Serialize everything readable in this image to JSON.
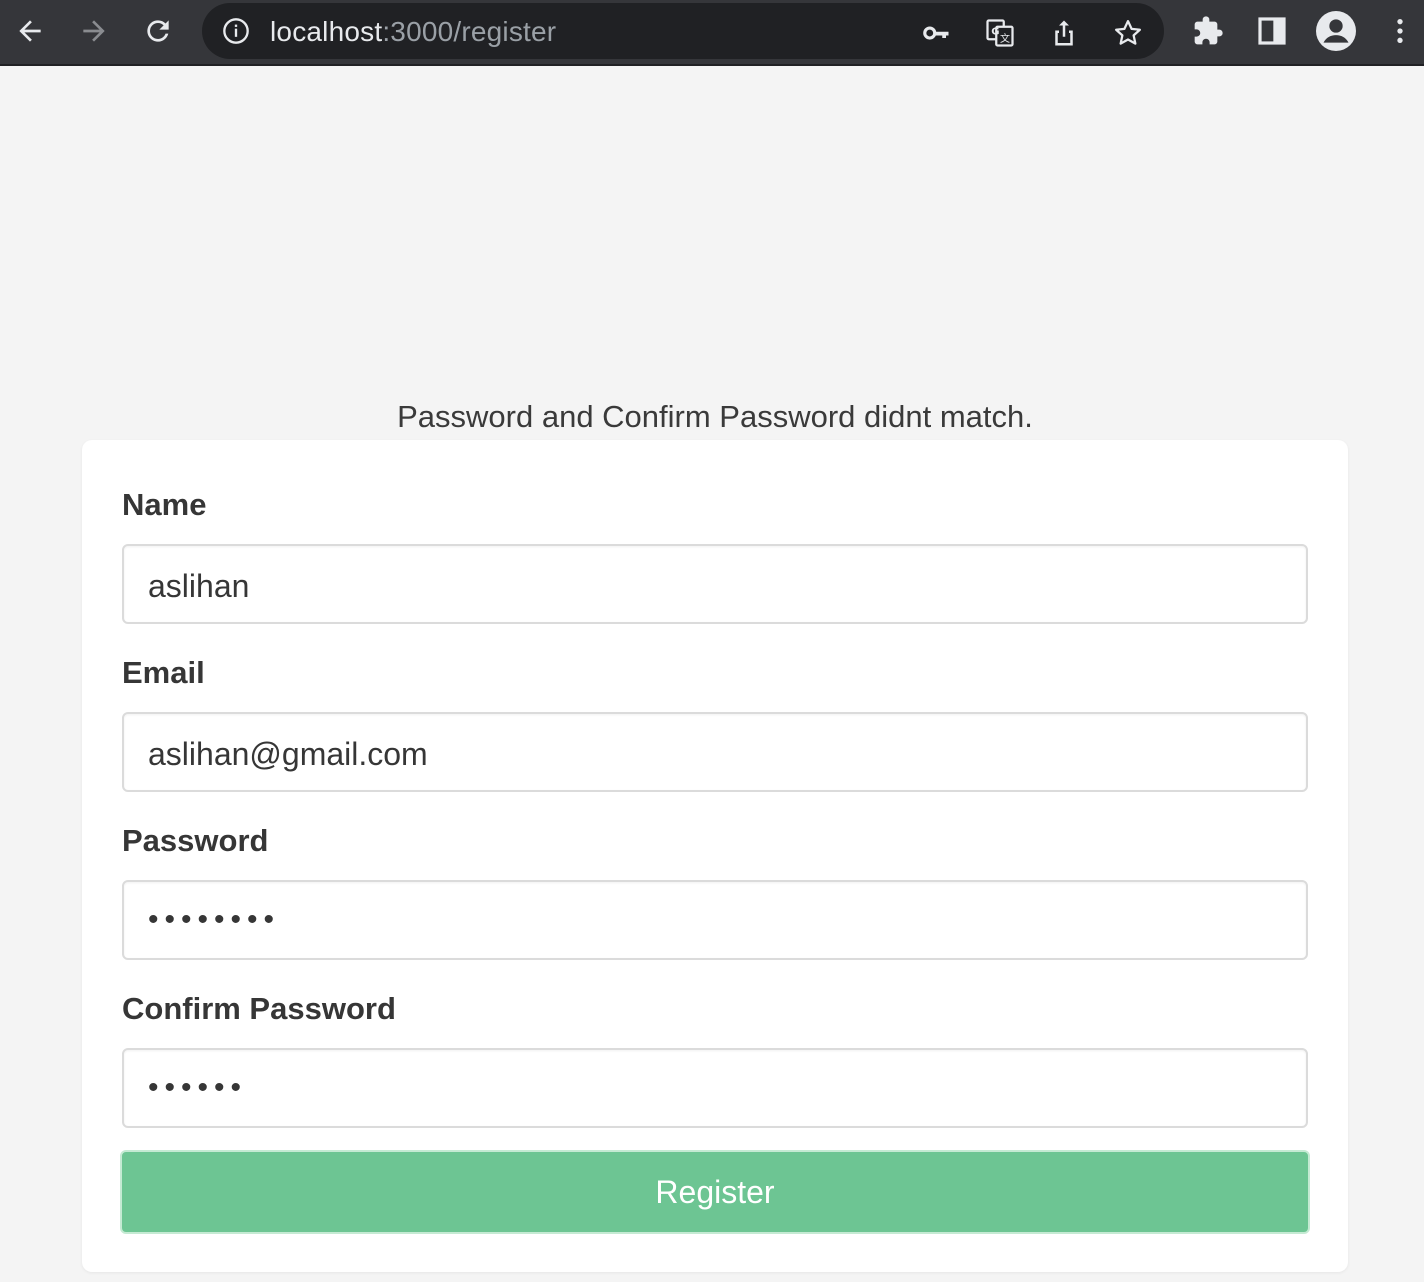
{
  "browser": {
    "url_host": "localhost",
    "url_path": ":3000/register"
  },
  "page": {
    "error_message": "Password and Confirm Password didnt match."
  },
  "form": {
    "name_label": "Name",
    "name_value": "aslihan",
    "email_label": "Email",
    "email_value": "aslihan@gmail.com",
    "password_label": "Password",
    "password_value": "••••••••",
    "confirm_label": "Confirm Password",
    "confirm_value": "••••••",
    "submit_label": "Register"
  },
  "colors": {
    "button_bg": "#6dc593",
    "toolbar_bg": "#35363a"
  }
}
